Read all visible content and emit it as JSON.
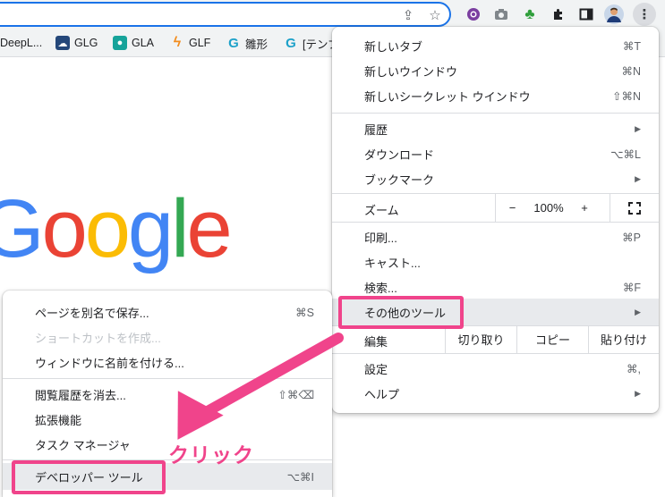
{
  "toolbar": {
    "icons": [
      "share-icon",
      "star-icon",
      "extension-purple-icon",
      "camera-icon",
      "clover-icon",
      "puzzle-icon",
      "sidepanel-icon",
      "profile-avatar",
      "three-dots-menu-icon"
    ],
    "share_glyph": "⇪",
    "star_glyph": "☆",
    "camera_glyph": "📷",
    "clover_glyph": "♣",
    "puzzle_glyph": "✚",
    "menu_glyph": "⋮"
  },
  "bookmarks": [
    {
      "label": "DeepL...",
      "icon": "deepl-icon"
    },
    {
      "label": "GLG",
      "icon": "glg-icon"
    },
    {
      "label": "GLA",
      "icon": "gla-icon"
    },
    {
      "label": "GLF",
      "icon": "glf-icon"
    },
    {
      "label": "雛形",
      "icon": "g-icon"
    },
    {
      "label": "[テンプ",
      "icon": "g-icon"
    }
  ],
  "logo": {
    "letters": [
      "G",
      "o",
      "o",
      "g",
      "l",
      "e"
    ],
    "colors": [
      "#4285f4",
      "#ea4335",
      "#fbbc05",
      "#4285f4",
      "#34a853",
      "#ea4335"
    ]
  },
  "main_menu": {
    "new_tab": {
      "label": "新しいタブ",
      "shortcut": "⌘T"
    },
    "new_window": {
      "label": "新しいウインドウ",
      "shortcut": "⌘N"
    },
    "new_incognito": {
      "label": "新しいシークレット ウインドウ",
      "shortcut": "⇧⌘N"
    },
    "history": {
      "label": "履歴"
    },
    "downloads": {
      "label": "ダウンロード",
      "shortcut": "⌥⌘L"
    },
    "bookmarks": {
      "label": "ブックマーク"
    },
    "zoom": {
      "label": "ズーム",
      "minus": "−",
      "value": "100%",
      "plus": "+",
      "fullscreen": "⛶"
    },
    "print": {
      "label": "印刷...",
      "shortcut": "⌘P"
    },
    "cast": {
      "label": "キャスト..."
    },
    "find": {
      "label": "検索...",
      "shortcut": "⌘F"
    },
    "more_tools": {
      "label": "その他のツール"
    },
    "edit": {
      "label": "編集",
      "cut": "切り取り",
      "copy": "コピー",
      "paste": "貼り付け"
    },
    "settings": {
      "label": "設定",
      "shortcut": "⌘,"
    },
    "help": {
      "label": "ヘルプ"
    }
  },
  "sub_menu": {
    "save_page": {
      "label": "ページを別名で保存...",
      "shortcut": "⌘S"
    },
    "create_shortcut": {
      "label": "ショートカットを作成...",
      "disabled": true
    },
    "name_window": {
      "label": "ウィンドウに名前を付ける..."
    },
    "clear_browsing": {
      "label": "閲覧履歴を消去...",
      "shortcut": "⇧⌘⌫"
    },
    "extensions": {
      "label": "拡張機能"
    },
    "task_manager": {
      "label": "タスク マネージャ"
    },
    "developer_tools": {
      "label": "デベロッパー ツール",
      "shortcut": "⌥⌘I"
    }
  },
  "annotation": {
    "callout_text": "クリック",
    "color": "#f0448b"
  },
  "arrow_glyph": "▶"
}
